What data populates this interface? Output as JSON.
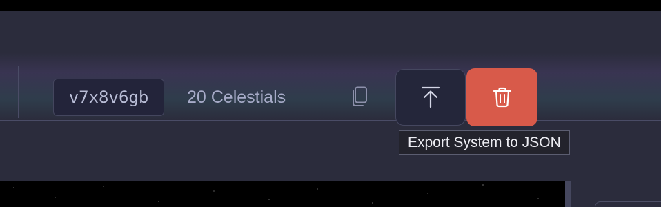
{
  "toolbar": {
    "system_id": "v7x8v6gb",
    "celestial_count": "20 Celestials",
    "copy_icon": "copy-icon",
    "export_icon": "upload-icon",
    "delete_icon": "trash-icon"
  },
  "tooltip": {
    "text": "Export System to JSON"
  },
  "colors": {
    "panel_bg": "#2b2c3c",
    "delete_button": "#d85a4a",
    "text_muted": "#a7abc8"
  }
}
